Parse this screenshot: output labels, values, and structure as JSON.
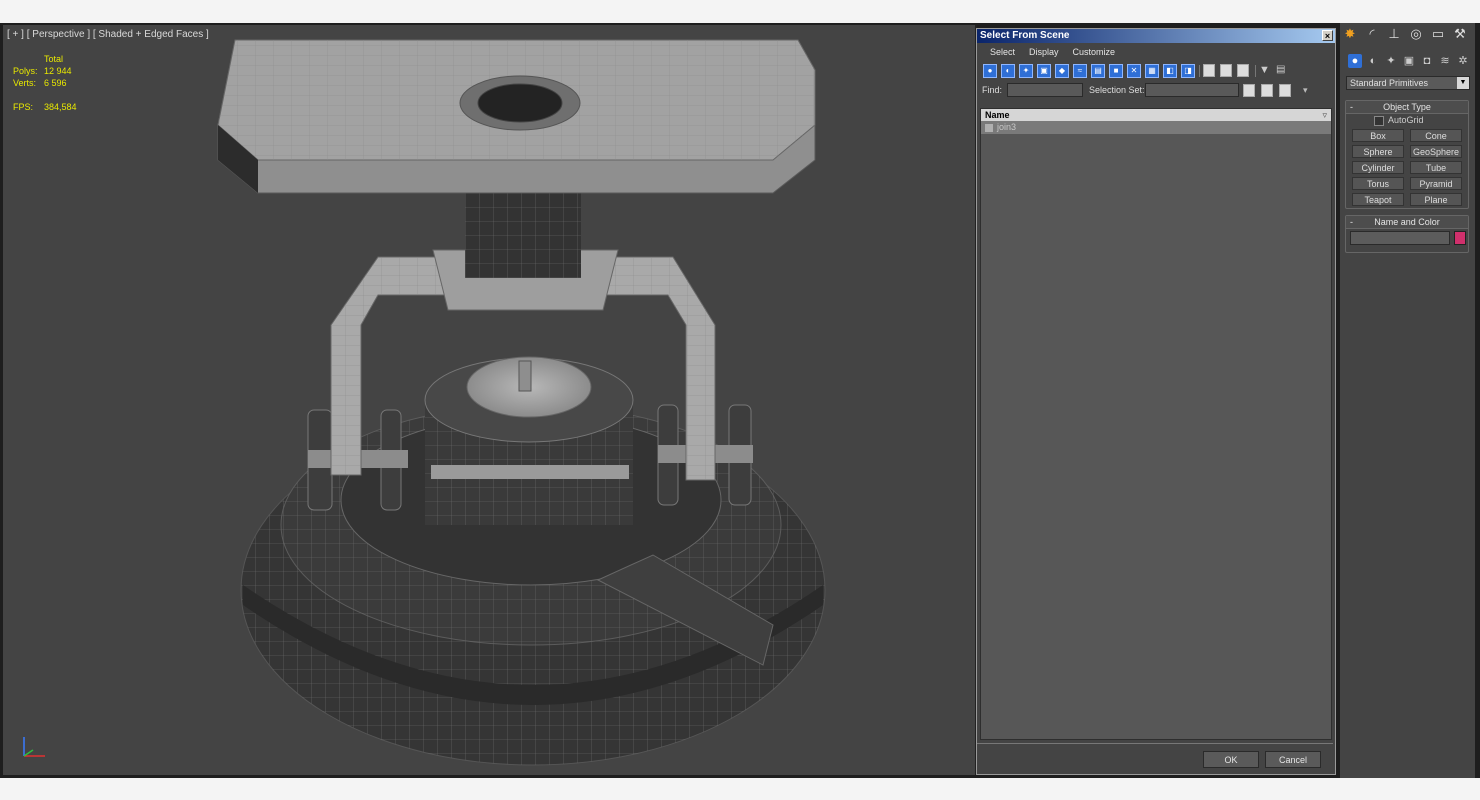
{
  "viewport": {
    "label": "[ + ] [ Perspective ] [ Shaded + Edged Faces ]",
    "stats": {
      "total_label": "Total",
      "polys_label": "Polys:",
      "polys_value": "12 944",
      "verts_label": "Verts:",
      "verts_value": "6 596",
      "fps_label": "FPS:",
      "fps_value": "384,584"
    }
  },
  "select_from_scene": {
    "title": "Select From Scene",
    "close_glyph": "×",
    "menu": [
      "Select",
      "Display",
      "Customize"
    ],
    "find_label": "Find:",
    "selection_set_label": "Selection Set:",
    "list_header": "Name",
    "items": [
      "join3"
    ],
    "ok_label": "OK",
    "cancel_label": "Cancel"
  },
  "command_panel": {
    "dropdown_value": "Standard Primitives",
    "object_type_title": "Object Type",
    "autogrid_label": "AutoGrid",
    "primitives": [
      "Box",
      "Cone",
      "Sphere",
      "GeoSphere",
      "Cylinder",
      "Tube",
      "Torus",
      "Pyramid",
      "Teapot",
      "Plane"
    ],
    "name_and_color_title": "Name and Color",
    "object_color": "#d0306c"
  }
}
